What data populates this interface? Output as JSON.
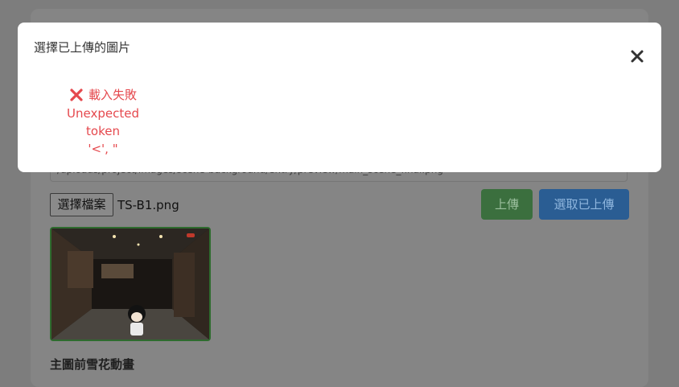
{
  "background": {
    "input_value": "/uploads/project/images/scene-background/entry/preview/main_scene_final.png",
    "file_button_label": "選擇檔案",
    "file_name": "TS-B1.png",
    "upload_button_label": "上傳",
    "pick_uploaded_button_label": "選取已上傳",
    "section_title": "主圖前雪花動畫"
  },
  "modal": {
    "title": "選擇已上傳的圖片",
    "close_icon": "close-icon",
    "error": {
      "icon": "x-mark-icon",
      "title": "載入失敗",
      "message_line1": "Unexpected token",
      "message_line2": "'<', \""
    }
  },
  "colors": {
    "overlay": "#7d7d7d",
    "error": "#e5484d",
    "upload_button": "#3b6f3e",
    "pick_button": "#2a5d93"
  }
}
